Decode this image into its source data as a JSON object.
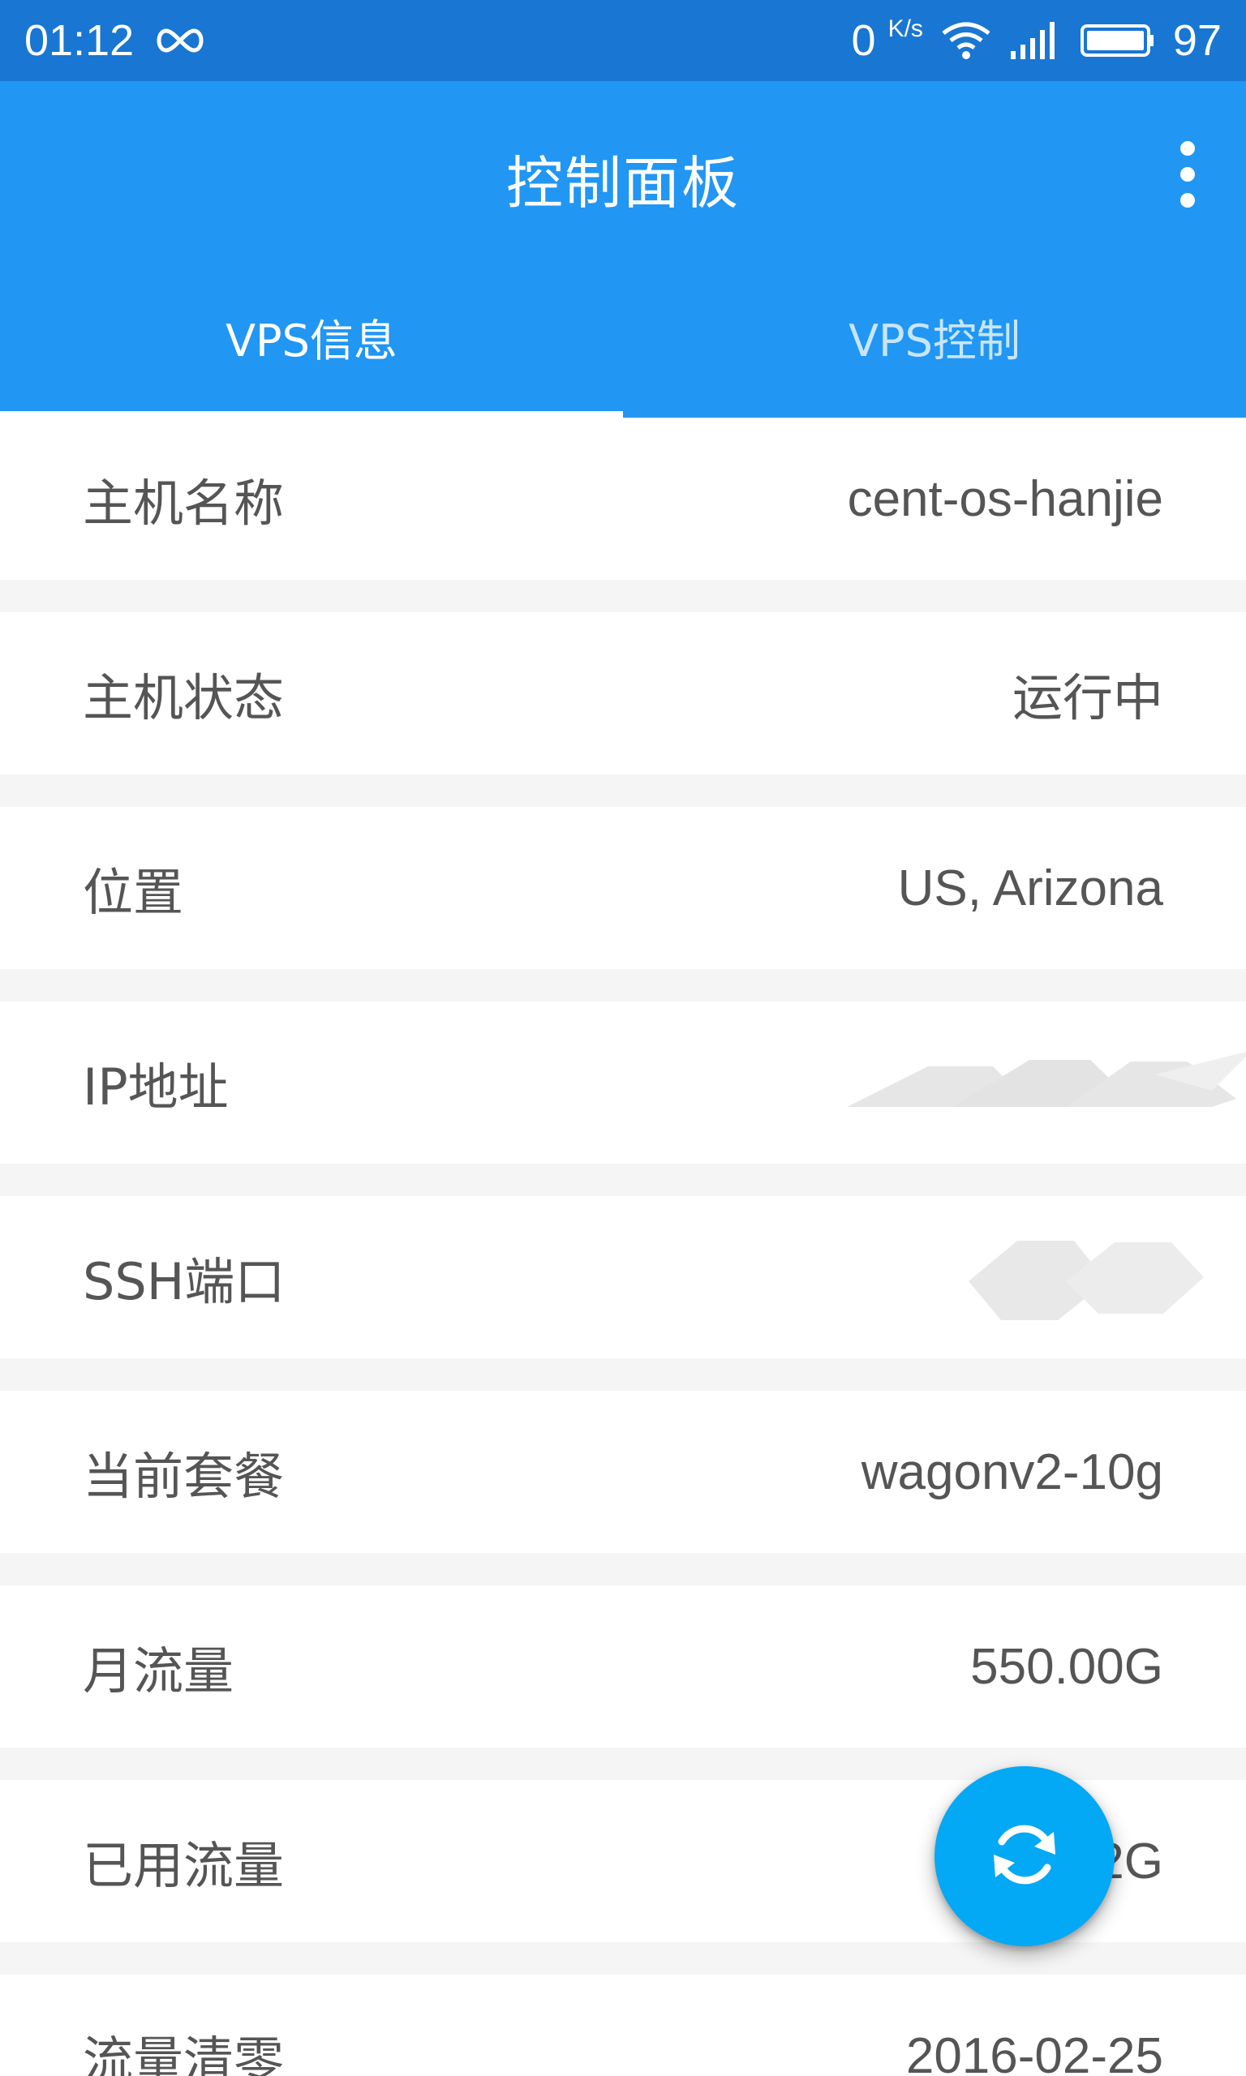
{
  "status_bar": {
    "time": "01:12",
    "network_speed": "0",
    "network_speed_unit": "K/s",
    "battery": "97",
    "icons": [
      "infinity-icon",
      "wifi-icon",
      "signal-icon",
      "battery-icon"
    ]
  },
  "app_bar": {
    "title": "控制面板",
    "menu_icon": "more-vert-icon"
  },
  "tabs": [
    {
      "label": "VPS信息",
      "active": true
    },
    {
      "label": "VPS控制",
      "active": false
    }
  ],
  "info": {
    "rows": [
      {
        "label": "主机名称",
        "value": "cent-os-hanjie"
      },
      {
        "label": "主机状态",
        "value": "运行中"
      },
      {
        "label": "位置",
        "value": "US, Arizona"
      },
      {
        "label": "IP地址",
        "value": ""
      },
      {
        "label": "SSH端口",
        "value": ""
      },
      {
        "label": "当前套餐",
        "value": "wagonv2-10g"
      },
      {
        "label": "月流量",
        "value": "550.00G"
      },
      {
        "label": "已用流量",
        "value": "2G"
      },
      {
        "label": "流量清零",
        "value": "2016-02-25"
      }
    ]
  },
  "fab": {
    "icon": "refresh-icon"
  },
  "colors": {
    "status_bar": "#1976D2",
    "app_bar": "#2196F3",
    "fab": "#03A9F4",
    "text": "#555555",
    "divider": "#F5F5F5"
  }
}
